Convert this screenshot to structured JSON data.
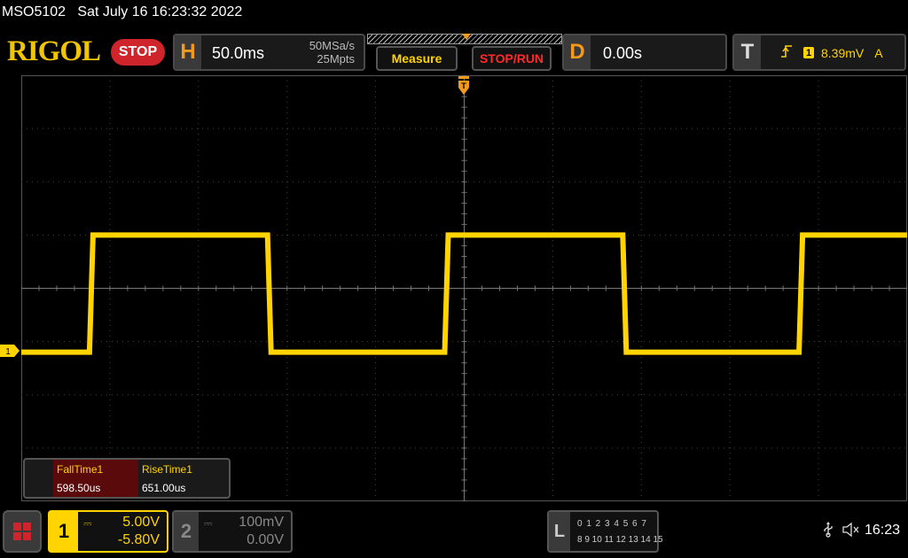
{
  "status": {
    "model": "MSO5102",
    "datetime": "Sat July 16 16:23:32 2022"
  },
  "brand": {
    "logo": "RIGOL",
    "run_state": "STOP"
  },
  "horizontal": {
    "tag": "H",
    "timebase": "50.0ms",
    "sample_rate": "50MSa/s",
    "memory_depth": "25Mpts"
  },
  "buttons": {
    "measure": "Measure",
    "stop_run": "STOP/RUN"
  },
  "delay": {
    "tag": "D",
    "value": "0.00s"
  },
  "trigger": {
    "tag": "T",
    "slope_icon": "rising-edge-icon",
    "source": "1",
    "level": "8.39mV",
    "mode": "A"
  },
  "measurements": [
    {
      "name": "FallTime1",
      "value": "598.50us"
    },
    {
      "name": "RiseTime1",
      "value": "651.00us"
    }
  ],
  "channel1": {
    "number": "1",
    "coupling": "DC",
    "scale": "5.00V",
    "offset": "-5.80V",
    "marker": "1",
    "color": "#ffd400"
  },
  "channel2": {
    "number": "2",
    "coupling": "DC",
    "scale": "100mV",
    "offset": "0.00V"
  },
  "logic": {
    "tag": "L",
    "row1": "0 1 2 3  4 5 6 7",
    "row2": "8 9 10 11 12 13 14 15"
  },
  "system": {
    "usb_icon": "usb-icon",
    "sound_icon": "speaker-muted-icon",
    "clock": "16:23"
  },
  "chart_data": {
    "type": "line",
    "title": "",
    "xlabel": "",
    "ylabel": "",
    "divisions": {
      "x": 10,
      "y": 8
    },
    "series": [
      {
        "name": "",
        "color": "#ffd400",
        "x_div": [
          0,
          0.77,
          0.81,
          2.78,
          2.82,
          4.78,
          4.82,
          6.79,
          6.83,
          8.78,
          8.82,
          10
        ],
        "y_div": [
          -1.2,
          -1.2,
          1.0,
          1.0,
          -1.2,
          -1.2,
          1.0,
          1.0,
          -1.2,
          -1.2,
          1.0,
          1.0
        ]
      }
    ]
  }
}
